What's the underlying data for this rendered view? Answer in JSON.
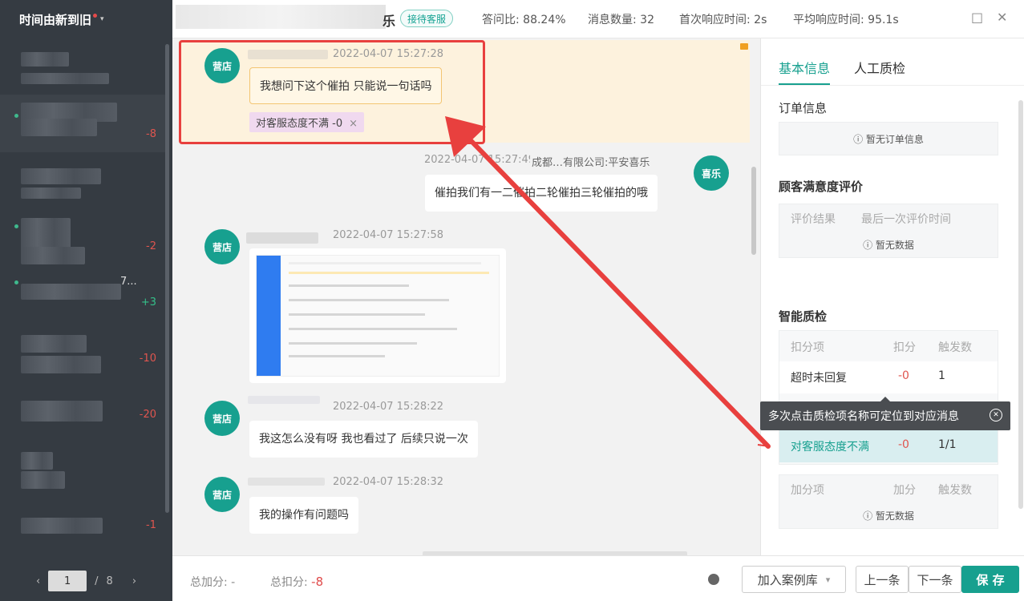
{
  "sidebar": {
    "sort_label": "时间由新到旧",
    "conversations": [
      {
        "score": ""
      },
      {
        "score": "-8"
      },
      {
        "score": ""
      },
      {
        "score": "-2"
      },
      {
        "score": "+3",
        "snippet": "7..."
      },
      {
        "score": "-10"
      },
      {
        "score": "-20"
      },
      {
        "score": ""
      },
      {
        "score": "-1"
      }
    ],
    "pager": {
      "prev": "‹",
      "page": "1",
      "sep": "/",
      "total": "8",
      "next": "›"
    }
  },
  "header": {
    "name_tail": "乐",
    "badge": "接待客服",
    "stats": [
      {
        "label": "答问比:",
        "value": "88.24%"
      },
      {
        "label": "消息数量:",
        "value": "32"
      },
      {
        "label": "首次响应时间:",
        "value": "2s"
      },
      {
        "label": "平均响应时间:",
        "value": "95.1s"
      }
    ],
    "maximize_glyph": "□",
    "close_glyph": "✕"
  },
  "messages": [
    {
      "avatar": "营店",
      "time": "2022-04-07 15:27:28",
      "text": "我想问下这个催拍 只能说一句话吗",
      "tag": "对客服态度不满 -0"
    },
    {
      "avatar": "喜乐",
      "time": "2022-04-07 15:27:49",
      "sender": "成都…有限公司:平安喜乐",
      "text": "催拍我们有一二催拍二轮催拍三轮催拍的哦"
    },
    {
      "avatar": "营店",
      "time": "2022-04-07 15:27:58",
      "text": ""
    },
    {
      "avatar": "营店",
      "time": "2022-04-07 15:28:22",
      "text": "我这怎么没有呀 我也看过了 后续只说一次"
    },
    {
      "avatar": "营店",
      "time": "2022-04-07 15:28:32",
      "text": "我的操作有问题吗"
    }
  ],
  "bottom": {
    "total_add_label": "总加分:",
    "total_add_value": "-",
    "total_deduct_label": "总扣分:",
    "total_deduct_value": "-8",
    "add_case": "加入案例库",
    "prev": "上一条",
    "next": "下一条",
    "save": "保 存"
  },
  "right": {
    "tabs": [
      "基本信息",
      "人工质检"
    ],
    "order_title": "订单信息",
    "order_empty": "暂无订单信息",
    "satisfaction_title": "顾客满意度评价",
    "satisfaction_cols": [
      "评价结果",
      "最后一次评价时间"
    ],
    "empty": "暂无数据",
    "smart_title": "智能质检",
    "deduct_cols": [
      "扣分项",
      "扣分",
      "触发数"
    ],
    "deduct_rows": [
      {
        "name": "超时未回复",
        "score": "-0",
        "count": "1"
      },
      {
        "name": "对客服态度不满",
        "score": "-0",
        "count": "1/1"
      }
    ],
    "add_cols": [
      "加分项",
      "加分",
      "触发数"
    ],
    "tooltip": "多次点击质检项名称可定位到对应消息"
  },
  "colors": {
    "accent": "#17a08f",
    "negative": "#e0554f",
    "positive": "#35c08a",
    "annotation": "#e8403e"
  }
}
